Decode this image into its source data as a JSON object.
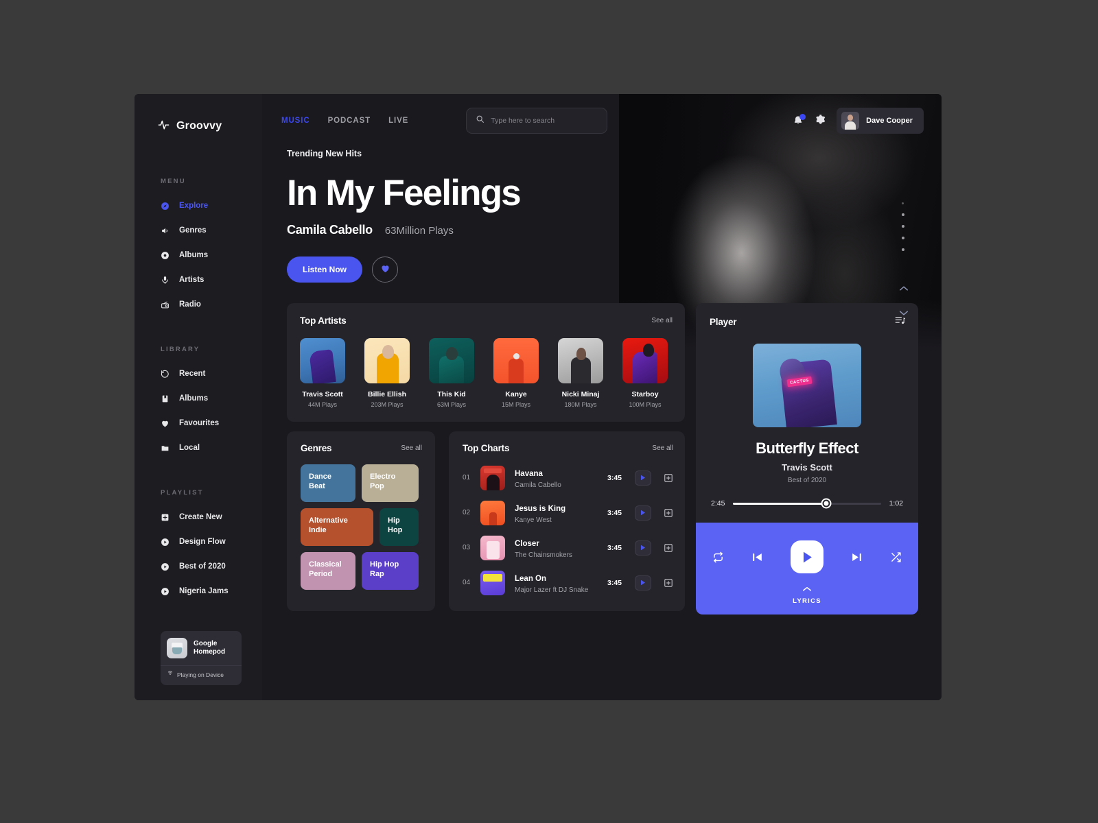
{
  "brand": {
    "name": "Groovvy",
    "icon": "waveform-icon"
  },
  "sidebar": {
    "menu_label": "MENU",
    "menu_items": [
      {
        "label": "Explore",
        "icon": "compass-icon",
        "active": true
      },
      {
        "label": "Genres",
        "icon": "speaker-icon",
        "active": false
      },
      {
        "label": "Albums",
        "icon": "disc-icon",
        "active": false
      },
      {
        "label": "Artists",
        "icon": "microphone-icon",
        "active": false
      },
      {
        "label": "Radio",
        "icon": "radio-icon",
        "active": false
      }
    ],
    "library_label": "LIBRARY",
    "library_items": [
      {
        "label": "Recent",
        "icon": "history-icon"
      },
      {
        "label": "Albums",
        "icon": "book-icon"
      },
      {
        "label": "Favourites",
        "icon": "heart-icon"
      },
      {
        "label": "Local",
        "icon": "folder-icon"
      }
    ],
    "playlist_label": "PLAYLIST",
    "playlist_items": [
      {
        "label": "Create New",
        "icon": "plus-square-icon"
      },
      {
        "label": "Design Flow",
        "icon": "play-circle-icon"
      },
      {
        "label": "Best of 2020",
        "icon": "play-circle-icon"
      },
      {
        "label": "Nigeria Jams",
        "icon": "play-circle-icon"
      }
    ],
    "device": {
      "name": "Google\nHomepod",
      "name_line1": "Google",
      "name_line2": "Homepod",
      "status": "Playing on Device",
      "status_icon": "cast-icon"
    }
  },
  "topbar": {
    "tabs": [
      {
        "label": "MUSIC",
        "active": true
      },
      {
        "label": "PODCAST",
        "active": false
      },
      {
        "label": "LIVE",
        "active": false
      }
    ],
    "search": {
      "placeholder": "Type here to search",
      "value": "",
      "icon": "search-icon"
    },
    "notification_icon": "bell-icon",
    "settings_icon": "gear-icon",
    "user": {
      "name": "Dave Cooper",
      "avatar": "user-avatar"
    }
  },
  "hero": {
    "kicker": "Trending New Hits",
    "title": "In My Feelings",
    "artist": "Camila Cabello",
    "plays": "63Million Plays",
    "listen_label": "Listen Now",
    "favourite_icon": "heart-icon",
    "slide_count": 5,
    "up_icon": "chevron-up-icon",
    "down_icon": "chevron-down-icon"
  },
  "top_artists": {
    "title": "Top Artists",
    "see_all": "See all",
    "items": [
      {
        "name": "Travis Scott",
        "plays": "44M Plays"
      },
      {
        "name": "Billie Ellish",
        "plays": "203M Plays"
      },
      {
        "name": "This Kid",
        "plays": "63M Plays"
      },
      {
        "name": "Kanye",
        "plays": "15M Plays"
      },
      {
        "name": "Nicki Minaj",
        "plays": "180M Plays"
      },
      {
        "name": "Starboy",
        "plays": "100M Plays"
      }
    ]
  },
  "genres": {
    "title": "Genres",
    "see_all": "See all",
    "items": [
      {
        "label": "Dance\nBeat",
        "line1": "Dance",
        "line2": "Beat",
        "color": "#44749c"
      },
      {
        "label": "Electro\nPop",
        "line1": "Electro",
        "line2": "Pop",
        "color": "#b9ae96"
      },
      {
        "label": "Alternative\nIndie",
        "line1": "Alternative",
        "line2": "Indie",
        "color": "#b6512d"
      },
      {
        "label": "Hip\nHop",
        "line1": "Hip",
        "line2": "Hop",
        "color": "#0d4340"
      },
      {
        "label": "Classical\nPeriod",
        "line1": "Classical",
        "line2": "Period",
        "color": "#c193b0"
      },
      {
        "label": "Hip Hop\nRap",
        "line1": "Hip Hop",
        "line2": "Rap",
        "color": "#5b3fc9"
      }
    ]
  },
  "top_charts": {
    "title": "Top Charts",
    "see_all": "See all",
    "rows": [
      {
        "index": "01",
        "title": "Havana",
        "artist": "Camila Cabello",
        "time": "3:45",
        "play_icon": "play-icon",
        "add_icon": "plus-square-icon"
      },
      {
        "index": "02",
        "title": "Jesus is King",
        "artist": "Kanye West",
        "time": "3:45",
        "play_icon": "play-icon",
        "add_icon": "plus-square-icon"
      },
      {
        "index": "03",
        "title": "Closer",
        "artist": "The Chainsmokers",
        "time": "3:45",
        "play_icon": "play-icon",
        "add_icon": "plus-square-icon"
      },
      {
        "index": "04",
        "title": "Lean On",
        "artist": "Major Lazer ft DJ Snake",
        "time": "3:45",
        "play_icon": "play-icon",
        "add_icon": "plus-square-icon"
      }
    ]
  },
  "player": {
    "title": "Player",
    "queue_icon": "queue-list-icon",
    "cover_text": "CACTUS",
    "track": "Butterfly Effect",
    "artist": "Travis Scott",
    "album": "Best of 2020",
    "elapsed": "2:45",
    "remaining": "1:02",
    "progress_percent": 63,
    "controls": {
      "repeat_icon": "repeat-icon",
      "previous_icon": "skip-previous-icon",
      "play_icon": "play-icon",
      "next_icon": "skip-next-icon",
      "shuffle_icon": "shuffle-icon"
    },
    "lyrics_label": "LYRICS",
    "lyrics_icon": "chevron-up-icon",
    "accent_color": "#5b63f5"
  }
}
